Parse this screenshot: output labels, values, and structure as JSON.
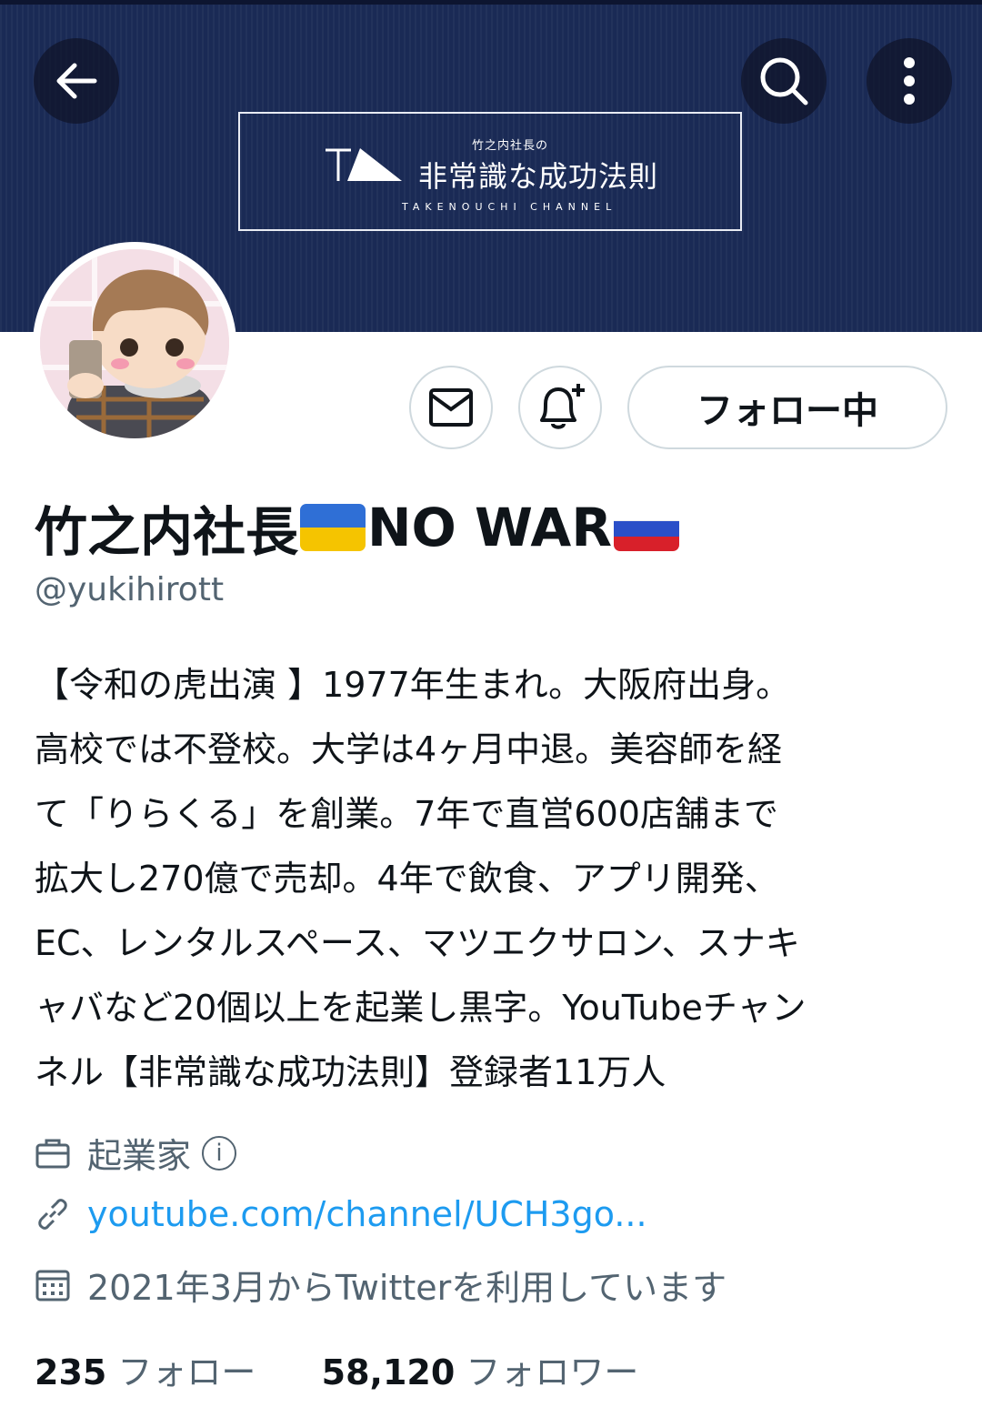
{
  "header": {
    "back_icon": "arrow-left-icon",
    "search_icon": "search-icon",
    "more_icon": "more-vertical-icon",
    "banner_logo": {
      "small_text": "竹之内社長の",
      "main_text": "非常識な成功法則",
      "sub_text": "TAKENOUCHI CHANNEL"
    }
  },
  "actions": {
    "message_icon": "mail-icon",
    "notify_icon": "bell-plus-icon",
    "follow_label": "フォロー中"
  },
  "profile": {
    "name_part1": "竹之内社長",
    "name_part2": "NO WAR",
    "flag_1": "ukraine-flag",
    "flag_2": "russia-flag",
    "handle": "@yukihirott",
    "bio_lines": [
      "【令和の虎出演 】1977年生まれ。大阪府出身。",
      "高校では不登校。大学は4ヶ月中退。美容師を経",
      "て「りらくる」を創業。7年で直営600店舗まで",
      "拡大し270億で売却。4年で飲食、アプリ開発、",
      "EC、レンタルスペース、マツエクサロン、スナキ",
      "ャバなど20個以上を起業し黒字。YouTubeチャン",
      "ネル【非常識な成功法則】登録者11万人"
    ],
    "category": "起業家",
    "link": "youtube.com/channel/UCH3go...",
    "joined": "2021年3月からTwitterを利用しています"
  },
  "stats": {
    "following_count": "235",
    "following_label": "フォロー",
    "followers_count": "58,120",
    "followers_label": "フォロワー"
  },
  "colors": {
    "banner": "#1a2a55",
    "link": "#1d9bf0",
    "secondary_text": "#536471",
    "ukraine_blue": "#2f6fd6",
    "ukraine_yellow": "#f5c400",
    "russia_red": "#d8202a"
  }
}
